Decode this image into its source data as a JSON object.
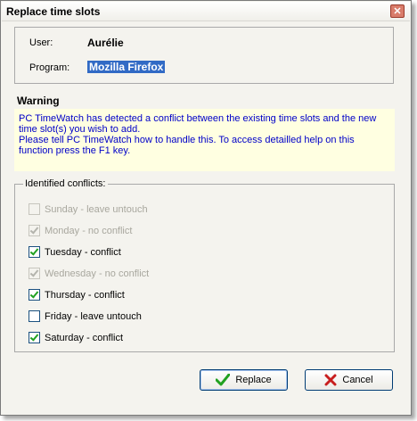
{
  "window": {
    "title": "Replace time slots"
  },
  "info": {
    "user_label": "User:",
    "user_value": "Aurélie",
    "program_label": "Program:",
    "program_value": "Mozilla Firefox"
  },
  "warning": {
    "title": "Warning",
    "text1": "PC TimeWatch has detected a conflict between the existing time slots and the new time slot(s) you wish to add.",
    "text2": "Please tell PC TimeWatch how to handle this. To access detailled help on this function press the F1 key."
  },
  "conflicts": {
    "legend": "Identified conflicts:",
    "items": [
      {
        "label": "Sunday - leave untouch",
        "checked": false,
        "enabled": false
      },
      {
        "label": "Monday - no conflict",
        "checked": true,
        "enabled": false
      },
      {
        "label": "Tuesday - conflict",
        "checked": true,
        "enabled": true
      },
      {
        "label": "Wednesday - no conflict",
        "checked": true,
        "enabled": false
      },
      {
        "label": "Thursday - conflict",
        "checked": true,
        "enabled": true
      },
      {
        "label": "Friday - leave untouch",
        "checked": false,
        "enabled": true
      },
      {
        "label": "Saturday - conflict",
        "checked": true,
        "enabled": true
      }
    ]
  },
  "buttons": {
    "replace_label": "Replace",
    "replace_icon": "checkmark-icon",
    "cancel_label": "Cancel",
    "cancel_icon": "x-icon"
  },
  "colors": {
    "warning_text": "#0000c8",
    "warning_bg": "#ffffe1",
    "selection_bg": "#316ac5",
    "check_green": "#21a121",
    "cancel_red": "#c81e1e"
  }
}
